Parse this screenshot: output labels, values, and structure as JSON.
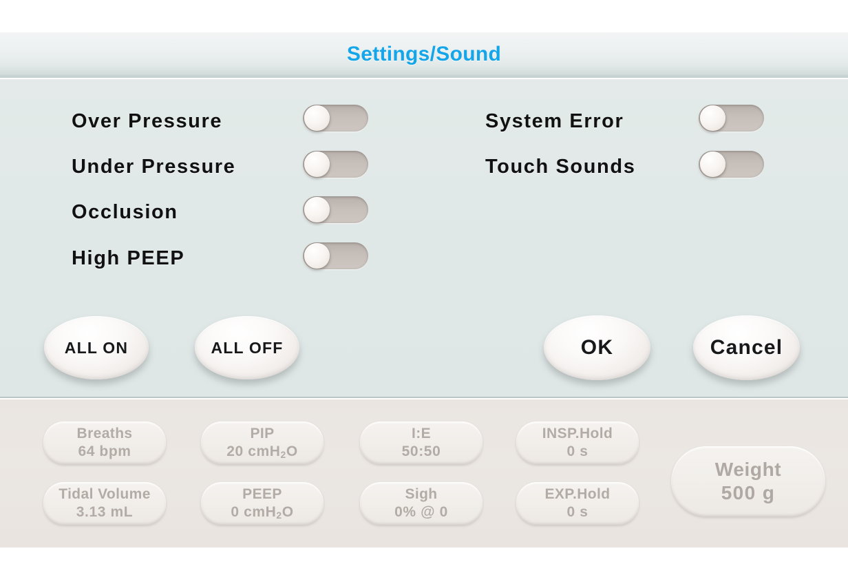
{
  "window": {
    "title": "Settings/Sound",
    "title_color": "#14a6e9",
    "panel_color": "#e0e8e7",
    "footer_color": "#e9e4e0"
  },
  "settings": {
    "left_column": [
      {
        "label": "Over  Pressure",
        "state": "off"
      },
      {
        "label": "Under  Pressure",
        "state": "off"
      },
      {
        "label": "Occlusion",
        "state": "off"
      },
      {
        "label": "High  PEEP",
        "state": "off"
      }
    ],
    "right_column": [
      {
        "label": "System  Error",
        "state": "off"
      },
      {
        "label": "Touch  Sounds",
        "state": "off"
      }
    ]
  },
  "actions": {
    "all_on": "ALL ON",
    "all_off": "ALL OFF",
    "ok": "OK",
    "cancel": "Cancel"
  },
  "status_bar": {
    "parameters": [
      {
        "label": "Breaths",
        "value": "64 bpm"
      },
      {
        "label": "Tidal Volume",
        "value": "3.13 mL"
      },
      {
        "label": "PIP",
        "value_prefix": "20  cmH",
        "value_sub": "2",
        "value_suffix": "O"
      },
      {
        "label": "PEEP",
        "value_prefix": "0  cmH",
        "value_sub": "2",
        "value_suffix": "O"
      },
      {
        "label": "I:E",
        "value": "50:50"
      },
      {
        "label": "Sigh",
        "value": "0% @ 0"
      },
      {
        "label": "INSP.Hold",
        "value": "0 s"
      },
      {
        "label": "EXP.Hold",
        "value": "0 s"
      }
    ],
    "weight": {
      "label": "Weight",
      "value": "500  g"
    }
  }
}
